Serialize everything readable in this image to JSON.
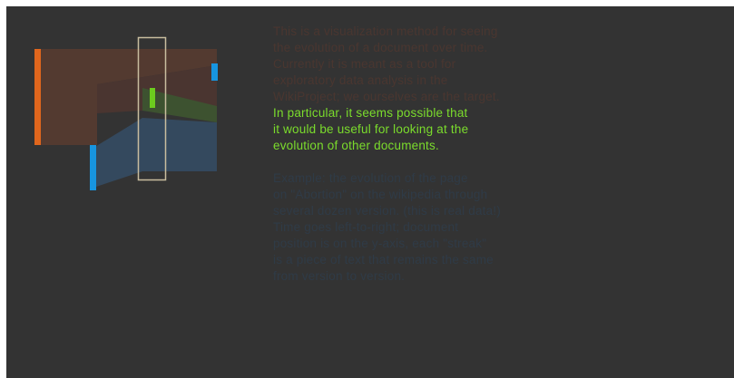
{
  "colors": {
    "background": "#333333",
    "text_dim_brown": "#4a3630",
    "text_highlight_green": "#7bdc2c",
    "text_dim_blue": "#2f3b47",
    "streak_orange": "#e0661d",
    "streak_blue": "#1795e0",
    "streak_green": "#6ccc1e",
    "selection_box": "#c9bd9f"
  },
  "intro": {
    "dim_lines": [
      "This is a visualization method for seeing",
      "the evolution of a document over time.",
      "Currently it is meant as a tool for",
      "exploratory data analysis in the",
      "WikiProject; we ourselves are the target."
    ],
    "highlight_lines": [
      "In particular, it seems possible that",
      "it would be useful for looking at the",
      "evolution of other documents."
    ]
  },
  "example": {
    "lines": [
      "Example: the evolution of the page",
      "on \"Abortion\" on the wikipedia through",
      "several dozen version. (this is real data!)",
      "Time goes left-to-right; document",
      "position is on the y-axis, each \"streak\"",
      "is a piece of text that remains the same",
      "from version to version."
    ]
  }
}
